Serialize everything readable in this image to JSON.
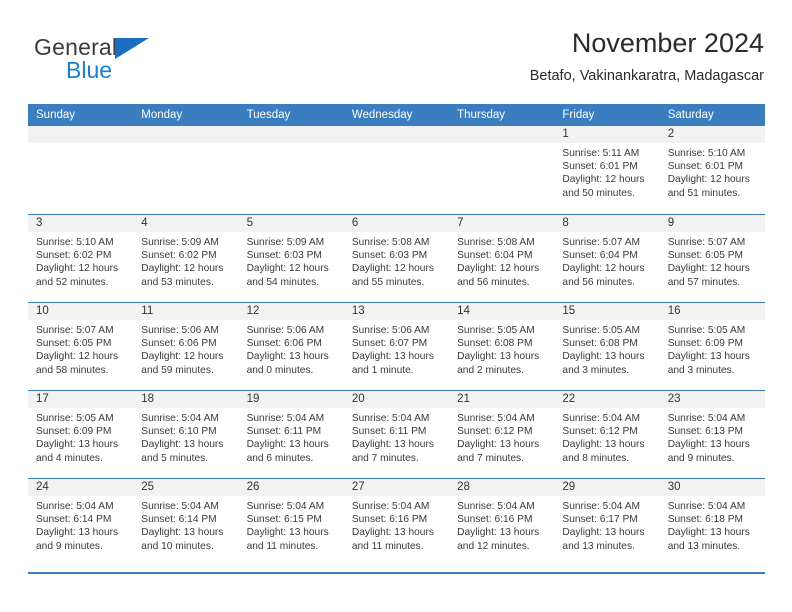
{
  "brand": {
    "name_dark": "General",
    "name_blue": "Blue",
    "triangle_color": "#1a6fc0",
    "blue_color": "#1a7fd4"
  },
  "header": {
    "title": "November 2024",
    "subtitle": "Betafo, Vakinankaratra, Madagascar"
  },
  "theme": {
    "header_blue": "#3a7ec0",
    "daynum_gray": "#f2f2f2"
  },
  "weekdays": [
    "Sunday",
    "Monday",
    "Tuesday",
    "Wednesday",
    "Thursday",
    "Friday",
    "Saturday"
  ],
  "weeks": [
    [
      {
        "day": "",
        "sunrise": "",
        "sunset": "",
        "daylight_line1": "",
        "daylight_line2": ""
      },
      {
        "day": "",
        "sunrise": "",
        "sunset": "",
        "daylight_line1": "",
        "daylight_line2": ""
      },
      {
        "day": "",
        "sunrise": "",
        "sunset": "",
        "daylight_line1": "",
        "daylight_line2": ""
      },
      {
        "day": "",
        "sunrise": "",
        "sunset": "",
        "daylight_line1": "",
        "daylight_line2": ""
      },
      {
        "day": "",
        "sunrise": "",
        "sunset": "",
        "daylight_line1": "",
        "daylight_line2": ""
      },
      {
        "day": "1",
        "sunrise": "Sunrise: 5:11 AM",
        "sunset": "Sunset: 6:01 PM",
        "daylight_line1": "Daylight: 12 hours",
        "daylight_line2": "and 50 minutes."
      },
      {
        "day": "2",
        "sunrise": "Sunrise: 5:10 AM",
        "sunset": "Sunset: 6:01 PM",
        "daylight_line1": "Daylight: 12 hours",
        "daylight_line2": "and 51 minutes."
      }
    ],
    [
      {
        "day": "3",
        "sunrise": "Sunrise: 5:10 AM",
        "sunset": "Sunset: 6:02 PM",
        "daylight_line1": "Daylight: 12 hours",
        "daylight_line2": "and 52 minutes."
      },
      {
        "day": "4",
        "sunrise": "Sunrise: 5:09 AM",
        "sunset": "Sunset: 6:02 PM",
        "daylight_line1": "Daylight: 12 hours",
        "daylight_line2": "and 53 minutes."
      },
      {
        "day": "5",
        "sunrise": "Sunrise: 5:09 AM",
        "sunset": "Sunset: 6:03 PM",
        "daylight_line1": "Daylight: 12 hours",
        "daylight_line2": "and 54 minutes."
      },
      {
        "day": "6",
        "sunrise": "Sunrise: 5:08 AM",
        "sunset": "Sunset: 6:03 PM",
        "daylight_line1": "Daylight: 12 hours",
        "daylight_line2": "and 55 minutes."
      },
      {
        "day": "7",
        "sunrise": "Sunrise: 5:08 AM",
        "sunset": "Sunset: 6:04 PM",
        "daylight_line1": "Daylight: 12 hours",
        "daylight_line2": "and 56 minutes."
      },
      {
        "day": "8",
        "sunrise": "Sunrise: 5:07 AM",
        "sunset": "Sunset: 6:04 PM",
        "daylight_line1": "Daylight: 12 hours",
        "daylight_line2": "and 56 minutes."
      },
      {
        "day": "9",
        "sunrise": "Sunrise: 5:07 AM",
        "sunset": "Sunset: 6:05 PM",
        "daylight_line1": "Daylight: 12 hours",
        "daylight_line2": "and 57 minutes."
      }
    ],
    [
      {
        "day": "10",
        "sunrise": "Sunrise: 5:07 AM",
        "sunset": "Sunset: 6:05 PM",
        "daylight_line1": "Daylight: 12 hours",
        "daylight_line2": "and 58 minutes."
      },
      {
        "day": "11",
        "sunrise": "Sunrise: 5:06 AM",
        "sunset": "Sunset: 6:06 PM",
        "daylight_line1": "Daylight: 12 hours",
        "daylight_line2": "and 59 minutes."
      },
      {
        "day": "12",
        "sunrise": "Sunrise: 5:06 AM",
        "sunset": "Sunset: 6:06 PM",
        "daylight_line1": "Daylight: 13 hours",
        "daylight_line2": "and 0 minutes."
      },
      {
        "day": "13",
        "sunrise": "Sunrise: 5:06 AM",
        "sunset": "Sunset: 6:07 PM",
        "daylight_line1": "Daylight: 13 hours",
        "daylight_line2": "and 1 minute."
      },
      {
        "day": "14",
        "sunrise": "Sunrise: 5:05 AM",
        "sunset": "Sunset: 6:08 PM",
        "daylight_line1": "Daylight: 13 hours",
        "daylight_line2": "and 2 minutes."
      },
      {
        "day": "15",
        "sunrise": "Sunrise: 5:05 AM",
        "sunset": "Sunset: 6:08 PM",
        "daylight_line1": "Daylight: 13 hours",
        "daylight_line2": "and 3 minutes."
      },
      {
        "day": "16",
        "sunrise": "Sunrise: 5:05 AM",
        "sunset": "Sunset: 6:09 PM",
        "daylight_line1": "Daylight: 13 hours",
        "daylight_line2": "and 3 minutes."
      }
    ],
    [
      {
        "day": "17",
        "sunrise": "Sunrise: 5:05 AM",
        "sunset": "Sunset: 6:09 PM",
        "daylight_line1": "Daylight: 13 hours",
        "daylight_line2": "and 4 minutes."
      },
      {
        "day": "18",
        "sunrise": "Sunrise: 5:04 AM",
        "sunset": "Sunset: 6:10 PM",
        "daylight_line1": "Daylight: 13 hours",
        "daylight_line2": "and 5 minutes."
      },
      {
        "day": "19",
        "sunrise": "Sunrise: 5:04 AM",
        "sunset": "Sunset: 6:11 PM",
        "daylight_line1": "Daylight: 13 hours",
        "daylight_line2": "and 6 minutes."
      },
      {
        "day": "20",
        "sunrise": "Sunrise: 5:04 AM",
        "sunset": "Sunset: 6:11 PM",
        "daylight_line1": "Daylight: 13 hours",
        "daylight_line2": "and 7 minutes."
      },
      {
        "day": "21",
        "sunrise": "Sunrise: 5:04 AM",
        "sunset": "Sunset: 6:12 PM",
        "daylight_line1": "Daylight: 13 hours",
        "daylight_line2": "and 7 minutes."
      },
      {
        "day": "22",
        "sunrise": "Sunrise: 5:04 AM",
        "sunset": "Sunset: 6:12 PM",
        "daylight_line1": "Daylight: 13 hours",
        "daylight_line2": "and 8 minutes."
      },
      {
        "day": "23",
        "sunrise": "Sunrise: 5:04 AM",
        "sunset": "Sunset: 6:13 PM",
        "daylight_line1": "Daylight: 13 hours",
        "daylight_line2": "and 9 minutes."
      }
    ],
    [
      {
        "day": "24",
        "sunrise": "Sunrise: 5:04 AM",
        "sunset": "Sunset: 6:14 PM",
        "daylight_line1": "Daylight: 13 hours",
        "daylight_line2": "and 9 minutes."
      },
      {
        "day": "25",
        "sunrise": "Sunrise: 5:04 AM",
        "sunset": "Sunset: 6:14 PM",
        "daylight_line1": "Daylight: 13 hours",
        "daylight_line2": "and 10 minutes."
      },
      {
        "day": "26",
        "sunrise": "Sunrise: 5:04 AM",
        "sunset": "Sunset: 6:15 PM",
        "daylight_line1": "Daylight: 13 hours",
        "daylight_line2": "and 11 minutes."
      },
      {
        "day": "27",
        "sunrise": "Sunrise: 5:04 AM",
        "sunset": "Sunset: 6:16 PM",
        "daylight_line1": "Daylight: 13 hours",
        "daylight_line2": "and 11 minutes."
      },
      {
        "day": "28",
        "sunrise": "Sunrise: 5:04 AM",
        "sunset": "Sunset: 6:16 PM",
        "daylight_line1": "Daylight: 13 hours",
        "daylight_line2": "and 12 minutes."
      },
      {
        "day": "29",
        "sunrise": "Sunrise: 5:04 AM",
        "sunset": "Sunset: 6:17 PM",
        "daylight_line1": "Daylight: 13 hours",
        "daylight_line2": "and 13 minutes."
      },
      {
        "day": "30",
        "sunrise": "Sunrise: 5:04 AM",
        "sunset": "Sunset: 6:18 PM",
        "daylight_line1": "Daylight: 13 hours",
        "daylight_line2": "and 13 minutes."
      }
    ]
  ]
}
